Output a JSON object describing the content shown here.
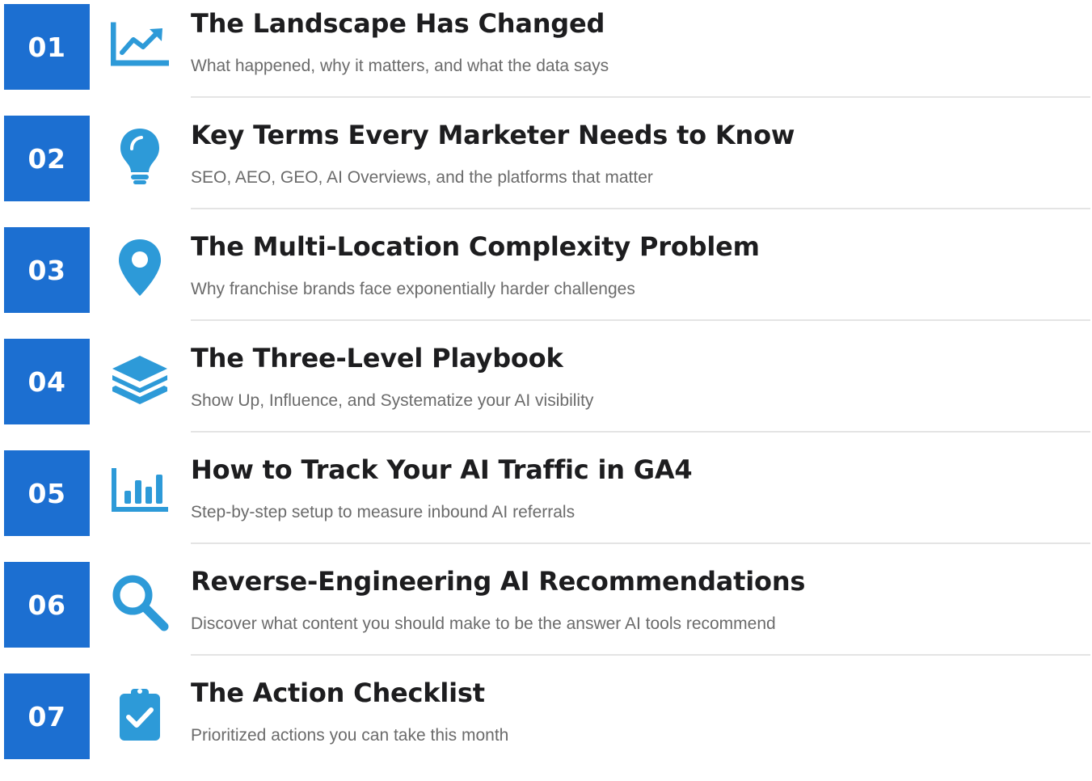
{
  "toc": {
    "accent_color": "#1c6fd1",
    "icon_color": "#2d9ad8",
    "items": [
      {
        "number": "01",
        "icon": "trending-up-chart-icon",
        "title": "The Landscape Has Changed",
        "subtitle": "What happened, why it matters, and what the data says"
      },
      {
        "number": "02",
        "icon": "lightbulb-icon",
        "title": "Key Terms Every Marketer Needs to Know",
        "subtitle": "SEO, AEO, GEO, AI Overviews, and the platforms that matter"
      },
      {
        "number": "03",
        "icon": "map-pin-icon",
        "title": "The Multi-Location Complexity Problem",
        "subtitle": "Why franchise brands face exponentially harder challenges"
      },
      {
        "number": "04",
        "icon": "layers-icon",
        "title": "The Three-Level Playbook",
        "subtitle": "Show Up, Influence, and Systematize your AI visibility"
      },
      {
        "number": "05",
        "icon": "bar-chart-icon",
        "title": "How to Track Your AI Traffic in GA4",
        "subtitle": "Step-by-step setup to measure inbound AI referrals"
      },
      {
        "number": "06",
        "icon": "search-icon",
        "title": "Reverse-Engineering AI Recommendations",
        "subtitle": "Discover what content you should make to be the answer AI tools recommend"
      },
      {
        "number": "07",
        "icon": "clipboard-check-icon",
        "title": "The Action Checklist",
        "subtitle": "Prioritized actions you can take this month"
      }
    ]
  }
}
